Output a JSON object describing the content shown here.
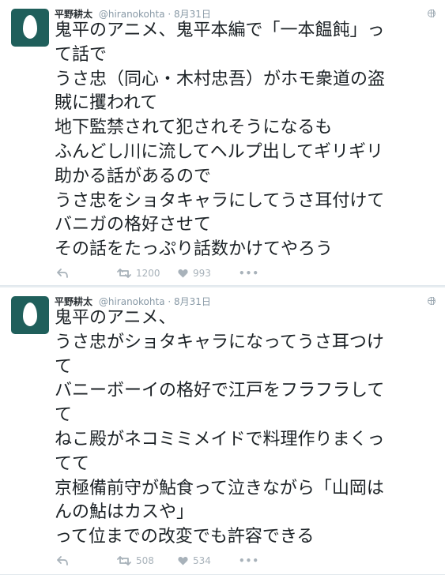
{
  "tweets": [
    {
      "name": "平野耕太",
      "handle": "@hiranokohta",
      "separator": "·",
      "date": "8月31日",
      "lines": [
        "鬼平のアニメ、鬼平本編で「一本饂飩」っ",
        "て話で",
        "うさ忠（同心・木村忠吾）がホモ衆道の盗",
        "賊に攫われて",
        "地下監禁されて犯されそうになるも",
        "ふんどし川に流してヘルプ出してギリギリ",
        "助かる話があるので",
        "うさ忠をショタキャラにしてうさ耳付けて",
        "バニガの格好させて",
        "その話をたっぷり話数かけてやろう"
      ],
      "retweets": "1200",
      "likes": "993",
      "more": "•••"
    },
    {
      "name": "平野耕太",
      "handle": "@hiranokohta",
      "separator": "·",
      "date": "8月31日",
      "lines": [
        "鬼平のアニメ、",
        "うさ忠がショタキャラになってうさ耳つけ",
        "て",
        "バニーボーイの格好で江戸をフラフラして",
        "て",
        "ねこ殿がネコミミメイドで料理作りまくっ",
        "てて",
        "京極備前守が鮎食って泣きながら「山岡は",
        "んの鮎はカスや」",
        "って位までの改変でも許容できる"
      ],
      "retweets": "508",
      "likes": "534",
      "more": "•••"
    }
  ],
  "icons": [
    "avatar-egg",
    "globe-icon",
    "reply-icon",
    "retweet-icon",
    "heart-icon",
    "more-icon"
  ],
  "colors": {
    "background": "#e6ecf0",
    "card": "#ffffff",
    "text": "#1c2226",
    "muted": "#8899a6",
    "avatar": "#1f5f5b"
  }
}
